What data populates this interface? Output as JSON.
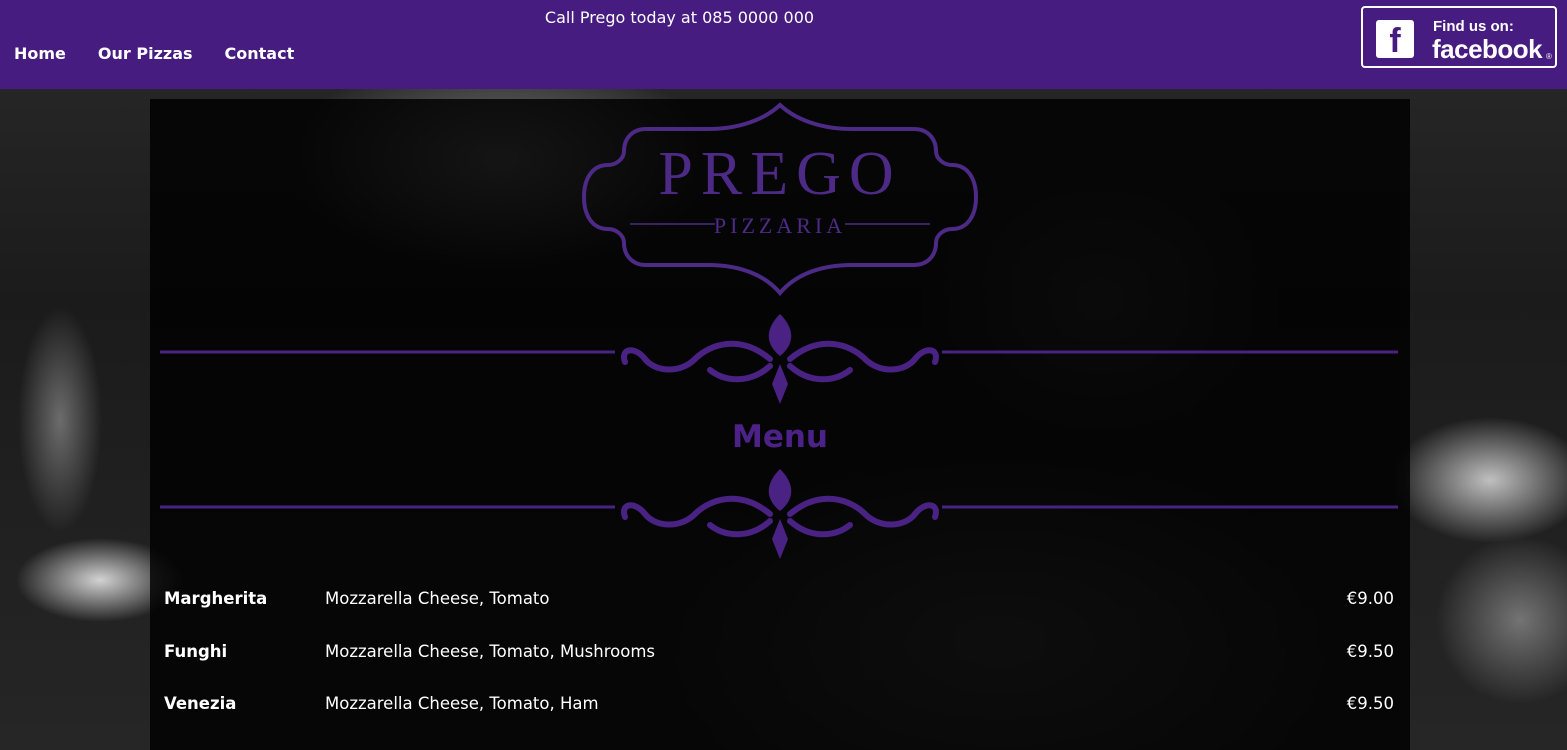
{
  "header": {
    "call_text": "Call Prego today at 085 0000 000",
    "nav": [
      {
        "label": "Home"
      },
      {
        "label": "Our Pizzas"
      },
      {
        "label": "Contact"
      }
    ],
    "facebook": {
      "f_letter": "f",
      "find_text": "Find us on:",
      "brand": "facebook",
      "reg": "®"
    },
    "bar_color": "#471c80"
  },
  "logo": {
    "name": "PREGO",
    "subtitle": "PIZZARIA",
    "color": "#4d2a86"
  },
  "menu": {
    "heading": "Menu",
    "items": [
      {
        "name": "Margherita",
        "description": "Mozzarella Cheese, Tomato",
        "price": "€9.00"
      },
      {
        "name": "Funghi",
        "description": "Mozzarella Cheese, Tomato, Mushrooms",
        "price": "€9.50"
      },
      {
        "name": "Venezia",
        "description": "Mozzarella Cheese, Tomato, Ham",
        "price": "€9.50"
      }
    ]
  }
}
